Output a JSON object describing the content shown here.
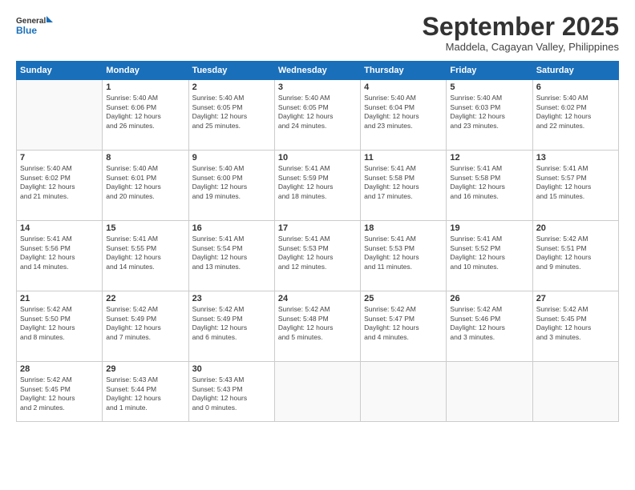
{
  "logo": {
    "line1": "General",
    "line2": "Blue"
  },
  "title": "September 2025",
  "subtitle": "Maddela, Cagayan Valley, Philippines",
  "days_of_week": [
    "Sunday",
    "Monday",
    "Tuesday",
    "Wednesday",
    "Thursday",
    "Friday",
    "Saturday"
  ],
  "weeks": [
    [
      {
        "day": "",
        "info": ""
      },
      {
        "day": "1",
        "info": "Sunrise: 5:40 AM\nSunset: 6:06 PM\nDaylight: 12 hours\nand 26 minutes."
      },
      {
        "day": "2",
        "info": "Sunrise: 5:40 AM\nSunset: 6:05 PM\nDaylight: 12 hours\nand 25 minutes."
      },
      {
        "day": "3",
        "info": "Sunrise: 5:40 AM\nSunset: 6:05 PM\nDaylight: 12 hours\nand 24 minutes."
      },
      {
        "day": "4",
        "info": "Sunrise: 5:40 AM\nSunset: 6:04 PM\nDaylight: 12 hours\nand 23 minutes."
      },
      {
        "day": "5",
        "info": "Sunrise: 5:40 AM\nSunset: 6:03 PM\nDaylight: 12 hours\nand 23 minutes."
      },
      {
        "day": "6",
        "info": "Sunrise: 5:40 AM\nSunset: 6:02 PM\nDaylight: 12 hours\nand 22 minutes."
      }
    ],
    [
      {
        "day": "7",
        "info": "Sunrise: 5:40 AM\nSunset: 6:02 PM\nDaylight: 12 hours\nand 21 minutes."
      },
      {
        "day": "8",
        "info": "Sunrise: 5:40 AM\nSunset: 6:01 PM\nDaylight: 12 hours\nand 20 minutes."
      },
      {
        "day": "9",
        "info": "Sunrise: 5:40 AM\nSunset: 6:00 PM\nDaylight: 12 hours\nand 19 minutes."
      },
      {
        "day": "10",
        "info": "Sunrise: 5:41 AM\nSunset: 5:59 PM\nDaylight: 12 hours\nand 18 minutes."
      },
      {
        "day": "11",
        "info": "Sunrise: 5:41 AM\nSunset: 5:58 PM\nDaylight: 12 hours\nand 17 minutes."
      },
      {
        "day": "12",
        "info": "Sunrise: 5:41 AM\nSunset: 5:58 PM\nDaylight: 12 hours\nand 16 minutes."
      },
      {
        "day": "13",
        "info": "Sunrise: 5:41 AM\nSunset: 5:57 PM\nDaylight: 12 hours\nand 15 minutes."
      }
    ],
    [
      {
        "day": "14",
        "info": "Sunrise: 5:41 AM\nSunset: 5:56 PM\nDaylight: 12 hours\nand 14 minutes."
      },
      {
        "day": "15",
        "info": "Sunrise: 5:41 AM\nSunset: 5:55 PM\nDaylight: 12 hours\nand 14 minutes."
      },
      {
        "day": "16",
        "info": "Sunrise: 5:41 AM\nSunset: 5:54 PM\nDaylight: 12 hours\nand 13 minutes."
      },
      {
        "day": "17",
        "info": "Sunrise: 5:41 AM\nSunset: 5:53 PM\nDaylight: 12 hours\nand 12 minutes."
      },
      {
        "day": "18",
        "info": "Sunrise: 5:41 AM\nSunset: 5:53 PM\nDaylight: 12 hours\nand 11 minutes."
      },
      {
        "day": "19",
        "info": "Sunrise: 5:41 AM\nSunset: 5:52 PM\nDaylight: 12 hours\nand 10 minutes."
      },
      {
        "day": "20",
        "info": "Sunrise: 5:42 AM\nSunset: 5:51 PM\nDaylight: 12 hours\nand 9 minutes."
      }
    ],
    [
      {
        "day": "21",
        "info": "Sunrise: 5:42 AM\nSunset: 5:50 PM\nDaylight: 12 hours\nand 8 minutes."
      },
      {
        "day": "22",
        "info": "Sunrise: 5:42 AM\nSunset: 5:49 PM\nDaylight: 12 hours\nand 7 minutes."
      },
      {
        "day": "23",
        "info": "Sunrise: 5:42 AM\nSunset: 5:49 PM\nDaylight: 12 hours\nand 6 minutes."
      },
      {
        "day": "24",
        "info": "Sunrise: 5:42 AM\nSunset: 5:48 PM\nDaylight: 12 hours\nand 5 minutes."
      },
      {
        "day": "25",
        "info": "Sunrise: 5:42 AM\nSunset: 5:47 PM\nDaylight: 12 hours\nand 4 minutes."
      },
      {
        "day": "26",
        "info": "Sunrise: 5:42 AM\nSunset: 5:46 PM\nDaylight: 12 hours\nand 3 minutes."
      },
      {
        "day": "27",
        "info": "Sunrise: 5:42 AM\nSunset: 5:45 PM\nDaylight: 12 hours\nand 3 minutes."
      }
    ],
    [
      {
        "day": "28",
        "info": "Sunrise: 5:42 AM\nSunset: 5:45 PM\nDaylight: 12 hours\nand 2 minutes."
      },
      {
        "day": "29",
        "info": "Sunrise: 5:43 AM\nSunset: 5:44 PM\nDaylight: 12 hours\nand 1 minute."
      },
      {
        "day": "30",
        "info": "Sunrise: 5:43 AM\nSunset: 5:43 PM\nDaylight: 12 hours\nand 0 minutes."
      },
      {
        "day": "",
        "info": ""
      },
      {
        "day": "",
        "info": ""
      },
      {
        "day": "",
        "info": ""
      },
      {
        "day": "",
        "info": ""
      }
    ]
  ]
}
